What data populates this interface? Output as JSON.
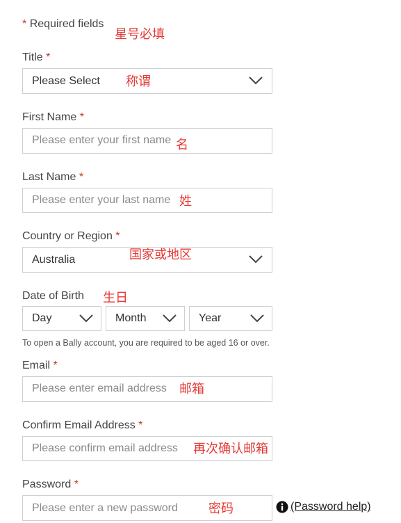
{
  "required_note": {
    "star": "*",
    "text": "Required fields",
    "annotation": "星号必填"
  },
  "title": {
    "label": "Title",
    "star": "*",
    "value": "Please Select",
    "annotation": "称谓"
  },
  "first_name": {
    "label": "First Name",
    "star": "*",
    "placeholder": "Please enter your first name",
    "annotation": "名"
  },
  "last_name": {
    "label": "Last Name",
    "star": "*",
    "placeholder": "Please enter your last name",
    "annotation": "姓"
  },
  "country": {
    "label": "Country or Region",
    "star": "*",
    "value": "Australia",
    "annotation": "国家或地区"
  },
  "dob": {
    "label": "Date of Birth",
    "annotation": "生日",
    "day": "Day",
    "month": "Month",
    "year": "Year",
    "note": "To open a Bally account, you are required to be aged 16 or over."
  },
  "email": {
    "label": "Email",
    "star": "*",
    "placeholder": "Please enter email address",
    "annotation": "邮箱"
  },
  "confirm_email": {
    "label": "Confirm Email Address",
    "star": "*",
    "placeholder": "Please confirm email address",
    "annotation": "再次确认邮箱"
  },
  "password": {
    "label": "Password",
    "star": "*",
    "placeholder": "Please enter a new password",
    "annotation": "密码",
    "help_link": "(Password help)",
    "info_icon": "info-icon"
  },
  "colors": {
    "required_star": "#c0392b",
    "annotation": "#e53935",
    "border": "#cfcfcf",
    "placeholder": "#8a8a8a"
  }
}
